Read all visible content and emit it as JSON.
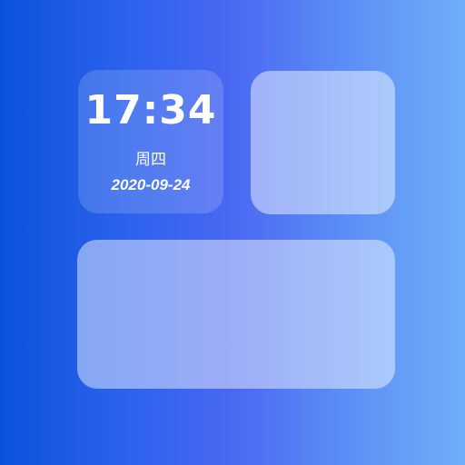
{
  "clock_widget": {
    "time": "17:34",
    "weekday": "周四",
    "date": "2020-09-24"
  },
  "colors": {
    "background_start": "#0b52d9",
    "background_end": "#6eaff9",
    "widget_fill": "#ffffff"
  }
}
